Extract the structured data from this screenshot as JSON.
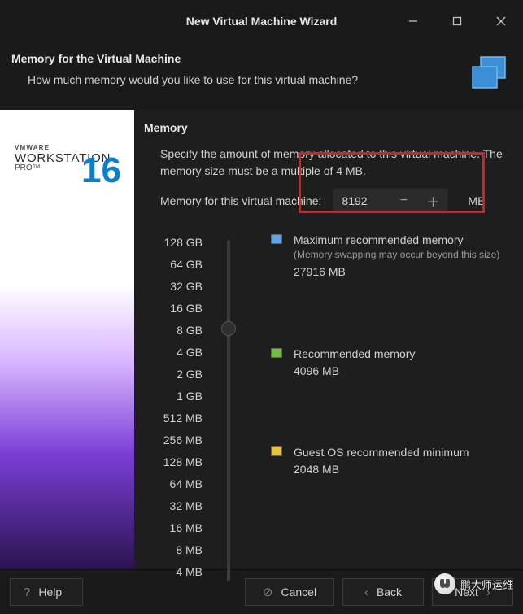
{
  "window": {
    "title": "New Virtual Machine Wizard"
  },
  "header": {
    "title": "Memory for the Virtual Machine",
    "desc": "How much memory would you like to use for this virtual machine?"
  },
  "logo": {
    "pre": "VMWARE",
    "main": "WORKSTATION",
    "pro": "PRO™",
    "num": "16"
  },
  "content": {
    "section_title": "Memory",
    "section_desc": "Specify the amount of memory allocated to this virtual machine. The memory size must be a multiple of 4 MB.",
    "mem_label": "Memory for this virtual machine:",
    "mem_value": "8192",
    "mem_unit": "MB",
    "scale_labels": [
      "128 GB",
      "64 GB",
      "32 GB",
      "16 GB",
      "8 GB",
      "4 GB",
      "2 GB",
      "1 GB",
      "512 MB",
      "256 MB",
      "128 MB",
      "64 MB",
      "32 MB",
      "16 MB",
      "8 MB",
      "4 MB"
    ],
    "legend": {
      "max": {
        "title": "Maximum recommended memory",
        "sub": "(Memory swapping may occur beyond this size)",
        "value": "27916 MB",
        "color": "#5da3e6"
      },
      "rec": {
        "title": "Recommended memory",
        "value": "4096 MB",
        "color": "#6fbf3a"
      },
      "min": {
        "title": "Guest OS recommended minimum",
        "value": "2048 MB",
        "color": "#e6c33a"
      }
    }
  },
  "footer": {
    "help": "Help",
    "cancel": "Cancel",
    "back": "Back",
    "next": "Next"
  },
  "watermark": "鹏大师运维"
}
